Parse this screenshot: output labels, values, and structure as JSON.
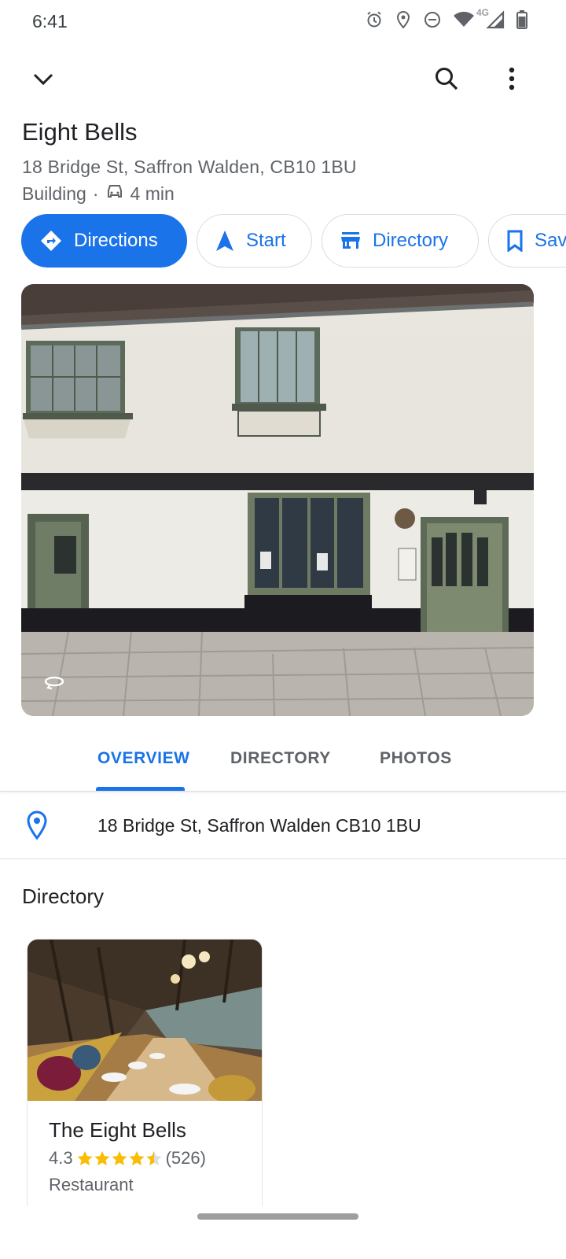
{
  "status_bar": {
    "time": "6:41",
    "network_label": "4G",
    "icons": [
      "alarm-icon",
      "location-icon",
      "do-not-disturb-icon",
      "wifi-icon",
      "cell-signal-icon",
      "battery-icon"
    ]
  },
  "top_bar": {
    "icons": [
      "chevron-down-icon",
      "search-icon",
      "more-vert-icon"
    ]
  },
  "place": {
    "name": "Eight Bells",
    "address": "18 Bridge St, Saffron Walden, CB10 1BU",
    "category": "Building",
    "separator": "·",
    "drive_time": "4 min"
  },
  "actions": [
    {
      "label": "Directions",
      "icon": "directions-icon",
      "primary": true
    },
    {
      "label": "Start",
      "icon": "navigation-icon",
      "primary": false
    },
    {
      "label": "Directory",
      "icon": "store-icon",
      "primary": false
    },
    {
      "label": "Save",
      "icon": "bookmark-icon",
      "primary": false
    }
  ],
  "photo": {
    "overlay_icon": "street-view-icon"
  },
  "tabs": [
    {
      "label": "OVERVIEW",
      "active": true
    },
    {
      "label": "DIRECTORY",
      "active": false
    },
    {
      "label": "PHOTOS",
      "active": false
    }
  ],
  "address_row": {
    "icon": "location-pin-icon",
    "text": "18 Bridge St, Saffron Walden CB10 1BU"
  },
  "directory": {
    "title": "Directory",
    "items": [
      {
        "name": "The Eight Bells",
        "rating": "4.3",
        "stars": 4.3,
        "review_count": "(526)",
        "type": "Restaurant"
      }
    ]
  },
  "colors": {
    "accent": "#1a73e8",
    "text_primary": "#202124",
    "text_secondary": "#5f6368",
    "star": "#fbbc04",
    "divider": "#dadce0"
  }
}
